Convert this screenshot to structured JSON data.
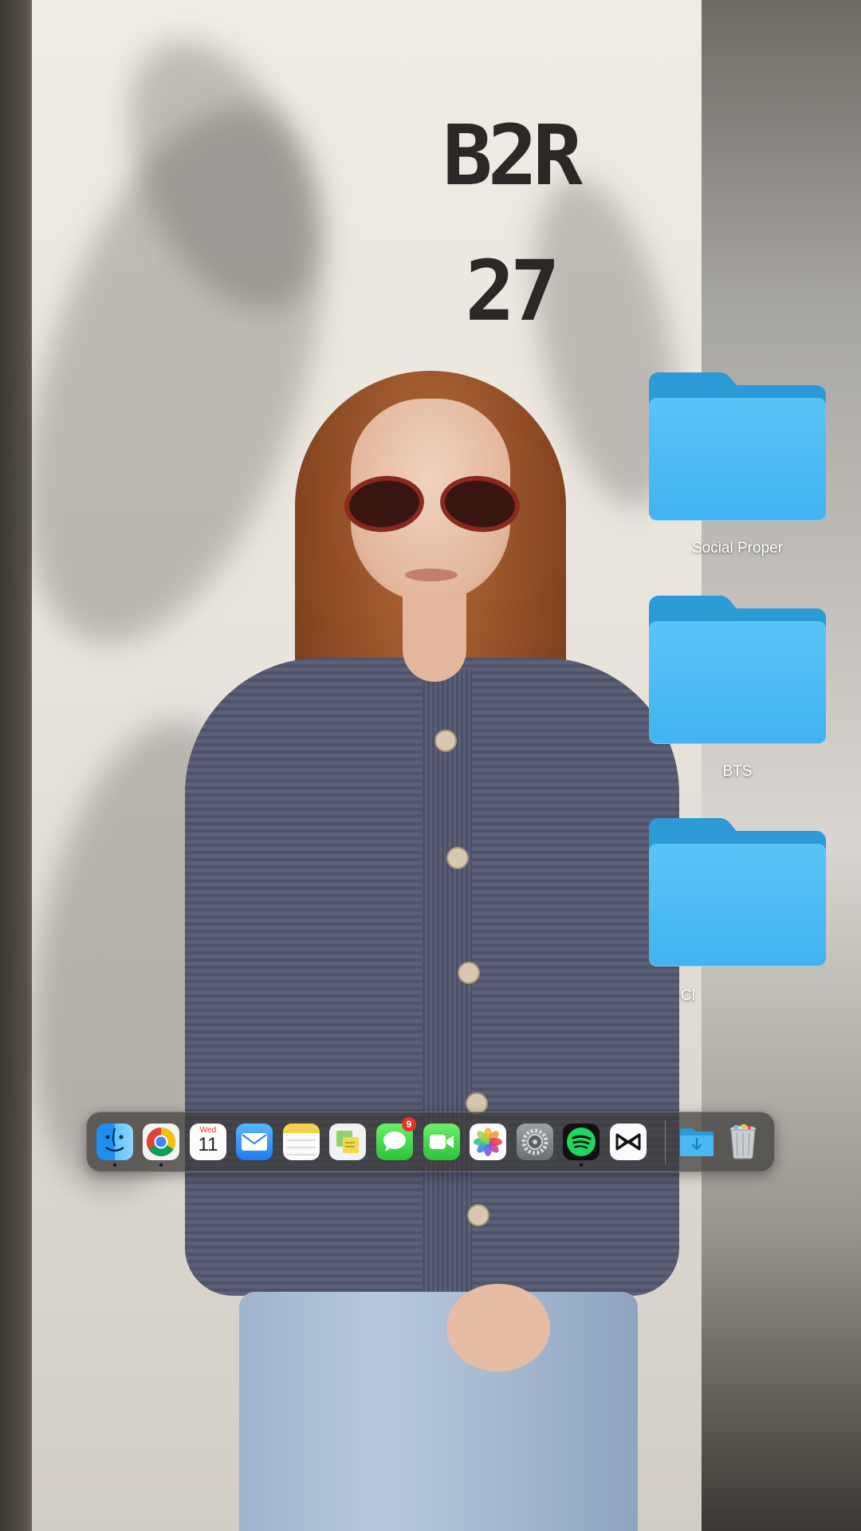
{
  "desktop": {
    "folders": [
      {
        "label": "Social Proper"
      },
      {
        "label": "BTS"
      },
      {
        "label": "Cl"
      }
    ]
  },
  "wallpaper": {
    "stencil_line1": "B2R",
    "stencil_line2": "27"
  },
  "dock": {
    "apps": [
      {
        "name": "Finder",
        "icon": "finder-icon",
        "running": true
      },
      {
        "name": "Google Chrome",
        "icon": "chrome-icon",
        "running": true
      },
      {
        "name": "Calendar",
        "icon": "calendar-icon",
        "running": false,
        "day_label": "Wed",
        "day_number": "11"
      },
      {
        "name": "Mail",
        "icon": "mail-icon",
        "running": false
      },
      {
        "name": "Notes",
        "icon": "notes-icon",
        "running": false
      },
      {
        "name": "Stickies",
        "icon": "stickies-icon",
        "running": false
      },
      {
        "name": "Messages",
        "icon": "messages-icon",
        "running": false,
        "badge": "9"
      },
      {
        "name": "FaceTime",
        "icon": "facetime-icon",
        "running": false
      },
      {
        "name": "Photos",
        "icon": "photos-icon",
        "running": false
      },
      {
        "name": "System Settings",
        "icon": "settings-gear-icon",
        "running": false
      },
      {
        "name": "Spotify",
        "icon": "spotify-icon",
        "running": true
      },
      {
        "name": "CapCut",
        "icon": "capcut-icon",
        "running": false
      },
      {
        "name": "Downloads",
        "icon": "downloads-folder-icon",
        "running": false
      },
      {
        "name": "Trash",
        "icon": "trash-icon",
        "running": false
      }
    ]
  },
  "colors": {
    "folder_front": "#42b3ef",
    "folder_back": "#2d9ad8",
    "badge_red": "#e9322c",
    "spotify_green": "#1ed760"
  }
}
